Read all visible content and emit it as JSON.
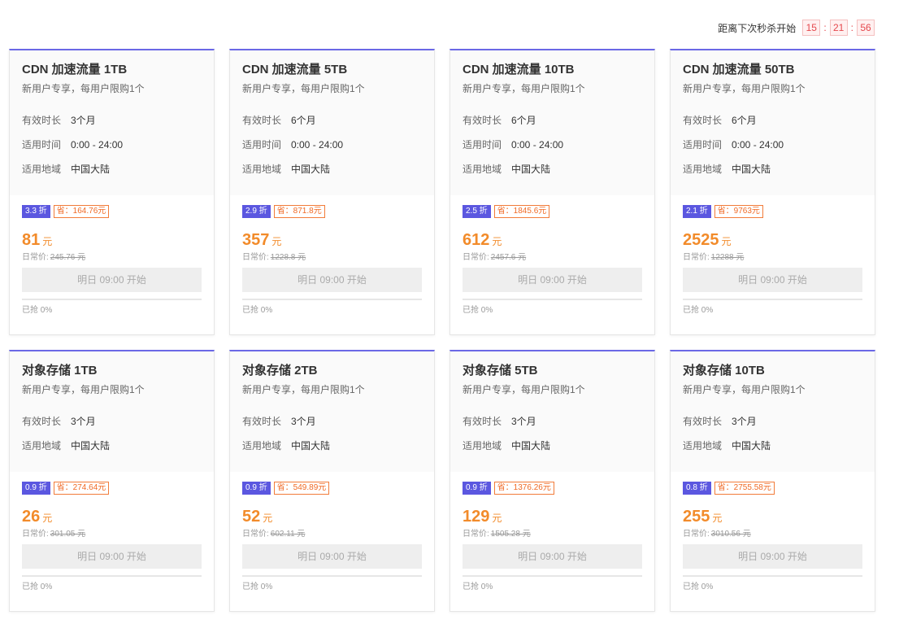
{
  "countdown": {
    "label": "距离下次秒杀开始",
    "hours": "15",
    "minutes": "21",
    "seconds": "56",
    "separator": ":"
  },
  "common": {
    "subtitle": "新用户专享，每用户限购1个",
    "original_price_label": "日常价:",
    "button_label": "明日 09:00 开始",
    "price_unit": "元",
    "accent_color": "#5b57e0",
    "price_color": "#f28b2a"
  },
  "cards": [
    {
      "title": "CDN 加速流量 1TB",
      "attrs": [
        {
          "name": "有效时长",
          "value": "3个月"
        },
        {
          "name": "适用时间",
          "value": "0:00 - 24:00"
        },
        {
          "name": "适用地域",
          "value": "中国大陆"
        }
      ],
      "discount": "3.3 折",
      "save": "省：164.76元",
      "price": "81",
      "original_price": "245.76 元",
      "sold": "已抢 0%",
      "sold_fraction": 0
    },
    {
      "title": "CDN 加速流量 5TB",
      "attrs": [
        {
          "name": "有效时长",
          "value": "6个月"
        },
        {
          "name": "适用时间",
          "value": "0:00 - 24:00"
        },
        {
          "name": "适用地域",
          "value": "中国大陆"
        }
      ],
      "discount": "2.9 折",
      "save": "省：871.8元",
      "price": "357",
      "original_price": "1228.8 元",
      "sold": "已抢 0%",
      "sold_fraction": 0
    },
    {
      "title": "CDN 加速流量 10TB",
      "attrs": [
        {
          "name": "有效时长",
          "value": "6个月"
        },
        {
          "name": "适用时间",
          "value": "0:00 - 24:00"
        },
        {
          "name": "适用地域",
          "value": "中国大陆"
        }
      ],
      "discount": "2.5 折",
      "save": "省：1845.6元",
      "price": "612",
      "original_price": "2457.6 元",
      "sold": "已抢 0%",
      "sold_fraction": 0
    },
    {
      "title": "CDN 加速流量 50TB",
      "attrs": [
        {
          "name": "有效时长",
          "value": "6个月"
        },
        {
          "name": "适用时间",
          "value": "0:00 - 24:00"
        },
        {
          "name": "适用地域",
          "value": "中国大陆"
        }
      ],
      "discount": "2.1 折",
      "save": "省：9763元",
      "price": "2525",
      "original_price": "12288 元",
      "sold": "已抢 0%",
      "sold_fraction": 0
    },
    {
      "title": "对象存储 1TB",
      "attrs": [
        {
          "name": "有效时长",
          "value": "3个月"
        },
        {
          "name": "适用地域",
          "value": "中国大陆"
        }
      ],
      "discount": "0.9 折",
      "save": "省：274.64元",
      "price": "26",
      "original_price": "301.05 元",
      "sold": "已抢 0%",
      "sold_fraction": 0
    },
    {
      "title": "对象存储 2TB",
      "attrs": [
        {
          "name": "有效时长",
          "value": "3个月"
        },
        {
          "name": "适用地域",
          "value": "中国大陆"
        }
      ],
      "discount": "0.9 折",
      "save": "省：549.89元",
      "price": "52",
      "original_price": "602.11 元",
      "sold": "已抢 0%",
      "sold_fraction": 0
    },
    {
      "title": "对象存储 5TB",
      "attrs": [
        {
          "name": "有效时长",
          "value": "3个月"
        },
        {
          "name": "适用地域",
          "value": "中国大陆"
        }
      ],
      "discount": "0.9 折",
      "save": "省：1376.26元",
      "price": "129",
      "original_price": "1505.28 元",
      "sold": "已抢 0%",
      "sold_fraction": 0
    },
    {
      "title": "对象存储 10TB",
      "attrs": [
        {
          "name": "有效时长",
          "value": "3个月"
        },
        {
          "name": "适用地域",
          "value": "中国大陆"
        }
      ],
      "discount": "0.8 折",
      "save": "省：2755.58元",
      "price": "255",
      "original_price": "3010.56 元",
      "sold": "已抢 0%",
      "sold_fraction": 0
    }
  ]
}
